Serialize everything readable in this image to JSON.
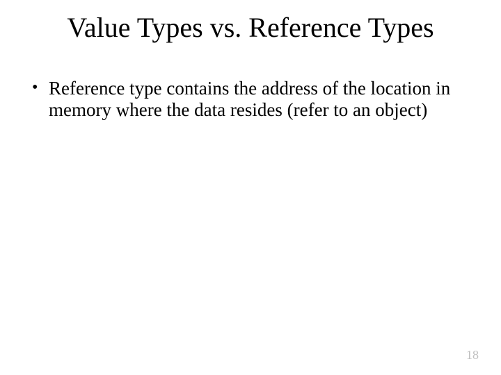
{
  "slide": {
    "title": "Value Types vs. Reference Types",
    "bullets": [
      "Reference type contains the address of the location in memory where the data resides (refer to an object)"
    ],
    "page_number": "18"
  }
}
